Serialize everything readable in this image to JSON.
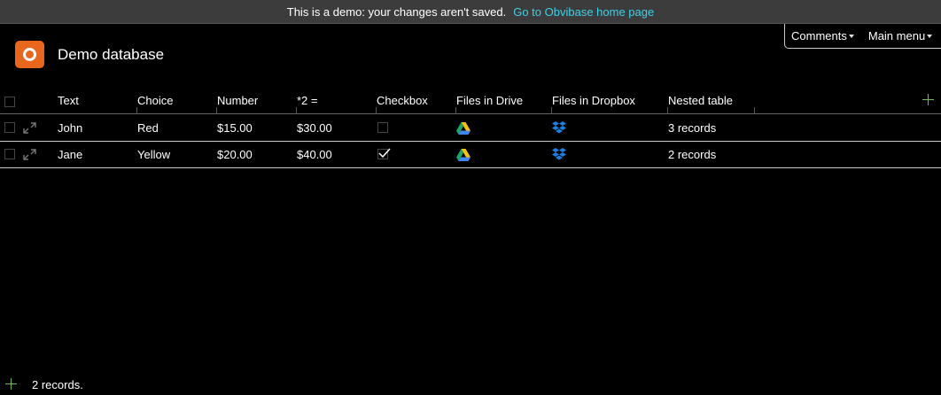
{
  "demo_bar": {
    "message": "This is a demo: your changes aren't saved.",
    "link": "Go to Obvibase home page"
  },
  "top_menu": {
    "comments": "Comments",
    "main_menu": "Main menu"
  },
  "app": {
    "title": "Demo database"
  },
  "table": {
    "columns": [
      "Text",
      "Choice",
      "Number",
      "*2 =",
      "Checkbox",
      "Files in Drive",
      "Files in Dropbox",
      "Nested table"
    ],
    "rows": [
      {
        "text": "John",
        "choice": "Red",
        "number": "$15.00",
        "double": "$30.00",
        "checkbox": false,
        "drive_icon": "google-drive-icon",
        "dropbox_icon": "dropbox-icon",
        "nested": "3 records"
      },
      {
        "text": "Jane",
        "choice": "Yellow",
        "number": "$20.00",
        "double": "$40.00",
        "checkbox": true,
        "drive_icon": "google-drive-icon",
        "dropbox_icon": "dropbox-icon",
        "nested": "2 records"
      }
    ]
  },
  "footer": {
    "count": "2 records."
  },
  "colors": {
    "demo_link": "#3fd0e8",
    "logo": "#e8671c",
    "add_plus": "#6dbb5a",
    "demo_bar_bg": "#3c3c3c"
  }
}
